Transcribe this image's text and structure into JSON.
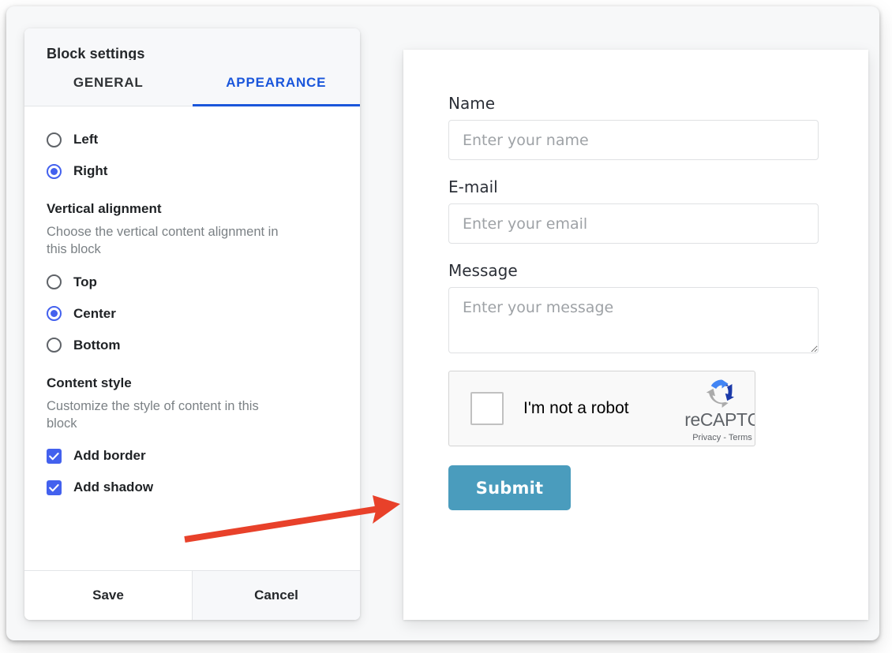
{
  "settings_panel": {
    "title": "Block settings",
    "tabs": [
      {
        "label": "GENERAL",
        "active": false
      },
      {
        "label": "APPEARANCE",
        "active": true
      }
    ],
    "horizontal_alignment": {
      "options": [
        {
          "label": "Left",
          "selected": false
        },
        {
          "label": "Right",
          "selected": true
        }
      ]
    },
    "vertical_alignment": {
      "title": "Vertical alignment",
      "description": "Choose the vertical content alignment in this block",
      "options": [
        {
          "label": "Top",
          "selected": false
        },
        {
          "label": "Center",
          "selected": true
        },
        {
          "label": "Bottom",
          "selected": false
        }
      ]
    },
    "content_style": {
      "title": "Content style",
      "description": "Customize the style of content in this block",
      "options": [
        {
          "label": "Add border",
          "checked": true
        },
        {
          "label": "Add shadow",
          "checked": true
        }
      ]
    },
    "footer": {
      "save_label": "Save",
      "cancel_label": "Cancel"
    },
    "colors": {
      "accent": "#1a56db",
      "control": "#4361ee",
      "header_bg": "#f7f8fa"
    }
  },
  "form_preview": {
    "fields": [
      {
        "label": "Name",
        "placeholder": "Enter your name",
        "value": "",
        "type": "text"
      },
      {
        "label": "E-mail",
        "placeholder": "Enter your email",
        "value": "",
        "type": "text"
      },
      {
        "label": "Message",
        "placeholder": "Enter your message",
        "value": "",
        "type": "textarea"
      }
    ],
    "recaptcha": {
      "checkbox_label": "I'm not a robot",
      "brand": "reCAPTC",
      "legal": "Privacy - Terms",
      "checked": false
    },
    "submit_label": "Submit",
    "colors": {
      "submit_bg": "#4a9cbd"
    }
  },
  "annotation": {
    "type": "arrow",
    "color": "#e8412a",
    "from": "Add shadow checkbox",
    "to": "Form preview card"
  }
}
